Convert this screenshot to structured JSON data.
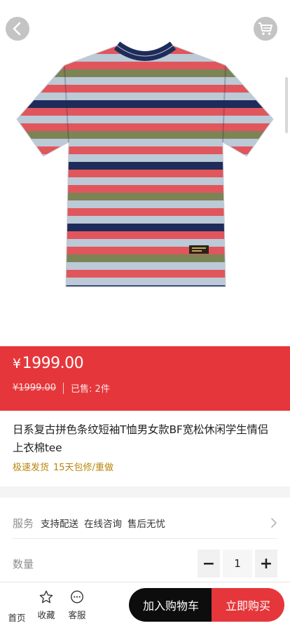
{
  "header": {
    "back_icon": "chevron-left-icon",
    "cart_icon": "shopping-cart-icon"
  },
  "product_image": {
    "stripe_colors": [
      "#1e2c5b",
      "#e0565c",
      "#bcc9d6",
      "#7c8455"
    ]
  },
  "price": {
    "currency": "¥",
    "current": "1999.00",
    "original": "¥1999.00",
    "sold_label": "已售: 2件"
  },
  "product": {
    "title": "日系复古拼色条纹短袖T恤男女款BF宽松休闲学生情侣上衣棉tee",
    "tags": [
      "极速发货",
      "15天包修/重做"
    ]
  },
  "service": {
    "label": "服务",
    "items": [
      "支持配送",
      "在线咨询",
      "售后无忧"
    ]
  },
  "quantity": {
    "label": "数量",
    "value": "1",
    "minus": "−",
    "plus": "+"
  },
  "bottom_nav": {
    "home_label": "首页",
    "favorite_label": "收藏",
    "service_label": "客服",
    "add_to_cart_label": "加入购物车",
    "buy_now_label": "立即购买"
  },
  "colors": {
    "accent": "#e5373b",
    "dark_button": "#0d0d0d",
    "tag_color": "#b8860b"
  }
}
